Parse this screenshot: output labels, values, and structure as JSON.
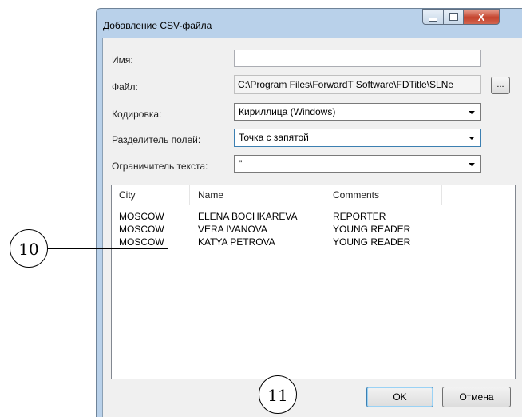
{
  "window": {
    "title": "Добавление CSV-файла",
    "controls": {
      "minimize": "–",
      "maximize": "□",
      "close": "X"
    }
  },
  "form": {
    "name_label": "Имя:",
    "name_value": "",
    "file_label": "Файл:",
    "file_value": "C:\\Program Files\\ForwardT Software\\FDTitle\\SLNe",
    "browse_label": "...",
    "encoding_label": "Кодировка:",
    "encoding_value": "Кириллица (Windows)",
    "separator_label": "Разделитель полей:",
    "separator_value": "Точка с запятой",
    "qualifier_label": "Ограничитель текста:",
    "qualifier_value": "\""
  },
  "preview": {
    "columns": [
      "City",
      "Name",
      "Comments"
    ],
    "rows": [
      [
        "MOSCOW",
        "ELENA BOCHKAREVA",
        "REPORTER"
      ],
      [
        "MOSCOW",
        "VERA IVANOVA",
        "YOUNG READER"
      ],
      [
        "MOSCOW",
        "KATYA PETROVA",
        "YOUNG READER"
      ]
    ]
  },
  "buttons": {
    "ok": "OK",
    "cancel": "Отмена"
  },
  "callouts": {
    "c10": "10",
    "c11": "11"
  }
}
